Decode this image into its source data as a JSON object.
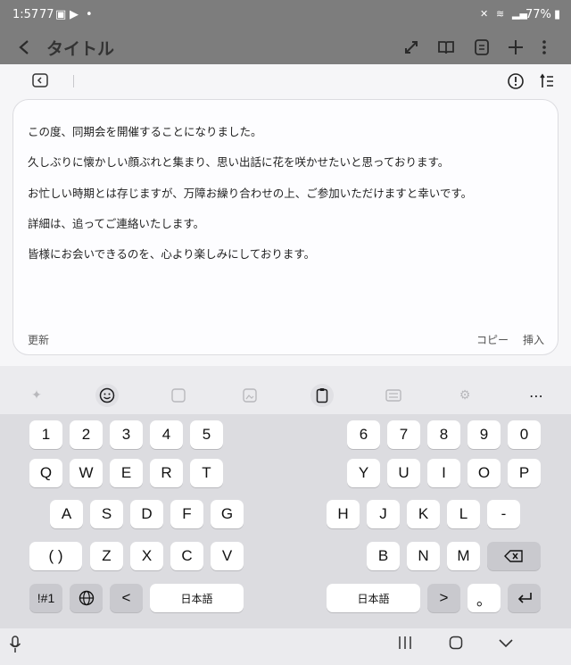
{
  "status": {
    "time": "1:57",
    "notif": "77",
    "battery": "77%"
  },
  "header": {
    "title": "タイトル"
  },
  "assist": {
    "lines": [
      "この度、同期会を開催することになりました。",
      "久しぶりに懐かしい顔ぶれと集まり、思い出話に花を咲かせたいと思っております。",
      "お忙しい時期とは存じますが、万障お繰り合わせの上、ご参加いただけますと幸いです。",
      "詳細は、追ってご連絡いたします。",
      "皆様にお会いできるのを、心より楽しみにしております。"
    ],
    "update_label": "更新",
    "copy_label": "コピー",
    "insert_label": "挿入"
  },
  "keyboard": {
    "left_rows": [
      [
        "1",
        "2",
        "3",
        "4",
        "5"
      ],
      [
        "Q",
        "W",
        "E",
        "R",
        "T"
      ],
      [
        "A",
        "S",
        "D",
        "F",
        "G"
      ],
      [
        "( )",
        "Z",
        "X",
        "C",
        "V"
      ]
    ],
    "right_rows": [
      [
        "6",
        "7",
        "8",
        "9",
        "0"
      ],
      [
        "Y",
        "U",
        "I",
        "O",
        "P"
      ],
      [
        "H",
        "J",
        "K",
        "L",
        "-"
      ],
      [
        "B",
        "N",
        "M"
      ]
    ],
    "sym_label": "!#1",
    "lang_label_left": "日本語",
    "lang_label_right": "日本語",
    "left_arrow": "<",
    "right_arrow": ">",
    "punct": "。"
  }
}
